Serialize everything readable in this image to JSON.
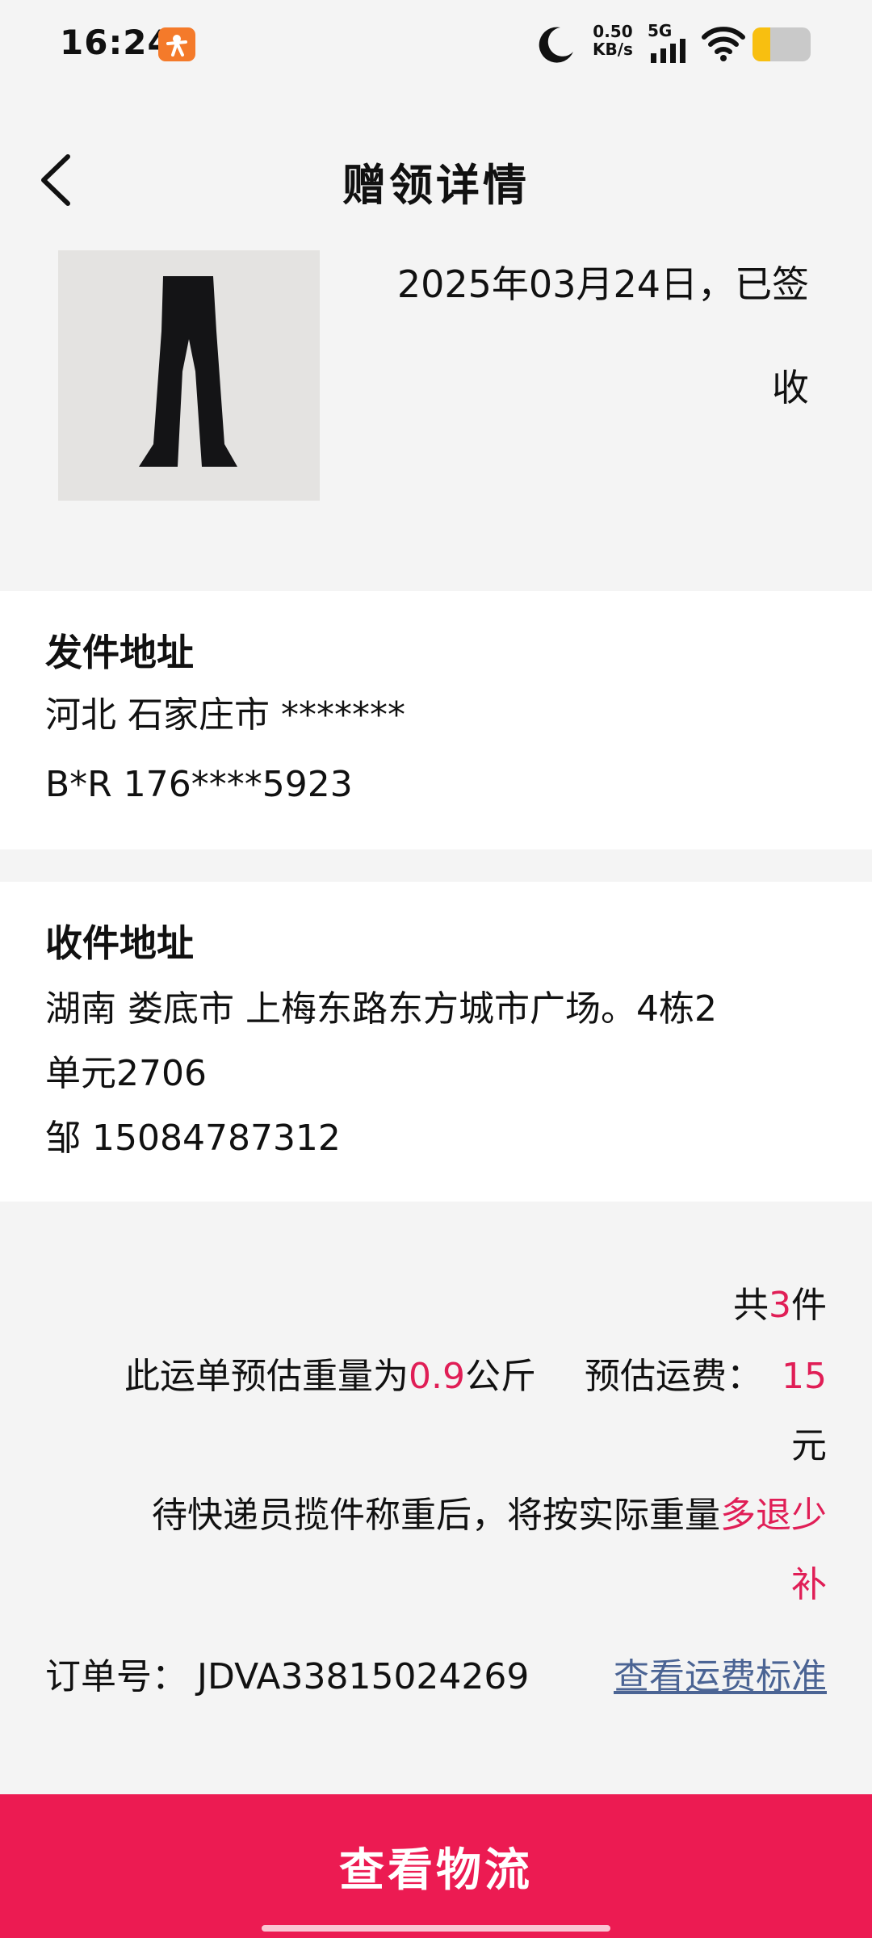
{
  "status_bar": {
    "time": "16:24",
    "net_speed_value": "0.50",
    "net_speed_unit": "KB/s",
    "network": "5G",
    "battery_level": 0.3
  },
  "header": {
    "title": "赠领详情"
  },
  "product": {
    "status_line1": "2025年03月24日，已签",
    "status_line2": "收"
  },
  "sender": {
    "title": "发件地址",
    "address": "河北 石家庄市 *******",
    "contact": "B*R 176****5923"
  },
  "receiver": {
    "title": "收件地址",
    "address_line1": "湖南 娄底市 上梅东路东方城市广场。4栋2",
    "address_line2": "单元2706",
    "contact": "邹 15084787312"
  },
  "shipping": {
    "count_prefix": "共",
    "count": "3",
    "count_suffix": "件",
    "weight_prefix": "此运单预估重量为",
    "weight_value": "0.9",
    "weight_unit": "公斤",
    "fee_label": "预估运费：",
    "fee_value": "15",
    "fee_unit": "元",
    "note_prefix": "待快递员揽件称重后，将按实际重量",
    "note_highlight1": "多退少",
    "note_highlight2": "补"
  },
  "order": {
    "label": "订单号：",
    "number": "JDVA33815024269",
    "link": "查看运费标准"
  },
  "bottom_button": {
    "label": "查看物流"
  },
  "colors": {
    "accent": "#ec1b52",
    "highlight_text": "#e01e56",
    "link": "#4b6494",
    "page_bg": "#f4f4f4"
  }
}
